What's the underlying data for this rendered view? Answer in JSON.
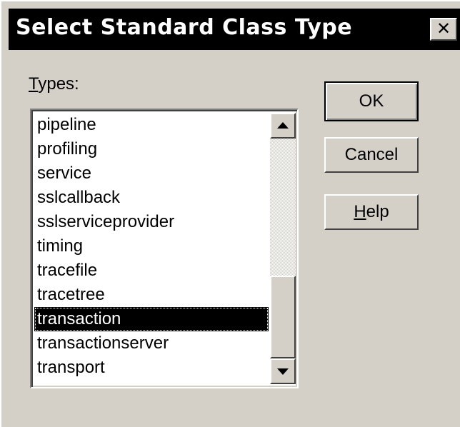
{
  "window": {
    "title": "Select Standard Class Type",
    "close_glyph": "✕"
  },
  "types_label": {
    "mnemonic": "T",
    "rest": "ypes:"
  },
  "list": {
    "items": [
      "pipeline",
      "profiling",
      "service",
      "sslcallback",
      "sslserviceprovider",
      "timing",
      "tracefile",
      "tracetree",
      "transaction",
      "transactionserver",
      "transport"
    ],
    "selected_item": "transaction"
  },
  "buttons": {
    "ok": "OK",
    "cancel": "Cancel",
    "help_mnemonic": "H",
    "help_rest": "elp"
  },
  "colors": {
    "face": "#d4d0c8",
    "titlebar": "#000000",
    "selection": "#000000",
    "selection_text": "#ffffff"
  }
}
